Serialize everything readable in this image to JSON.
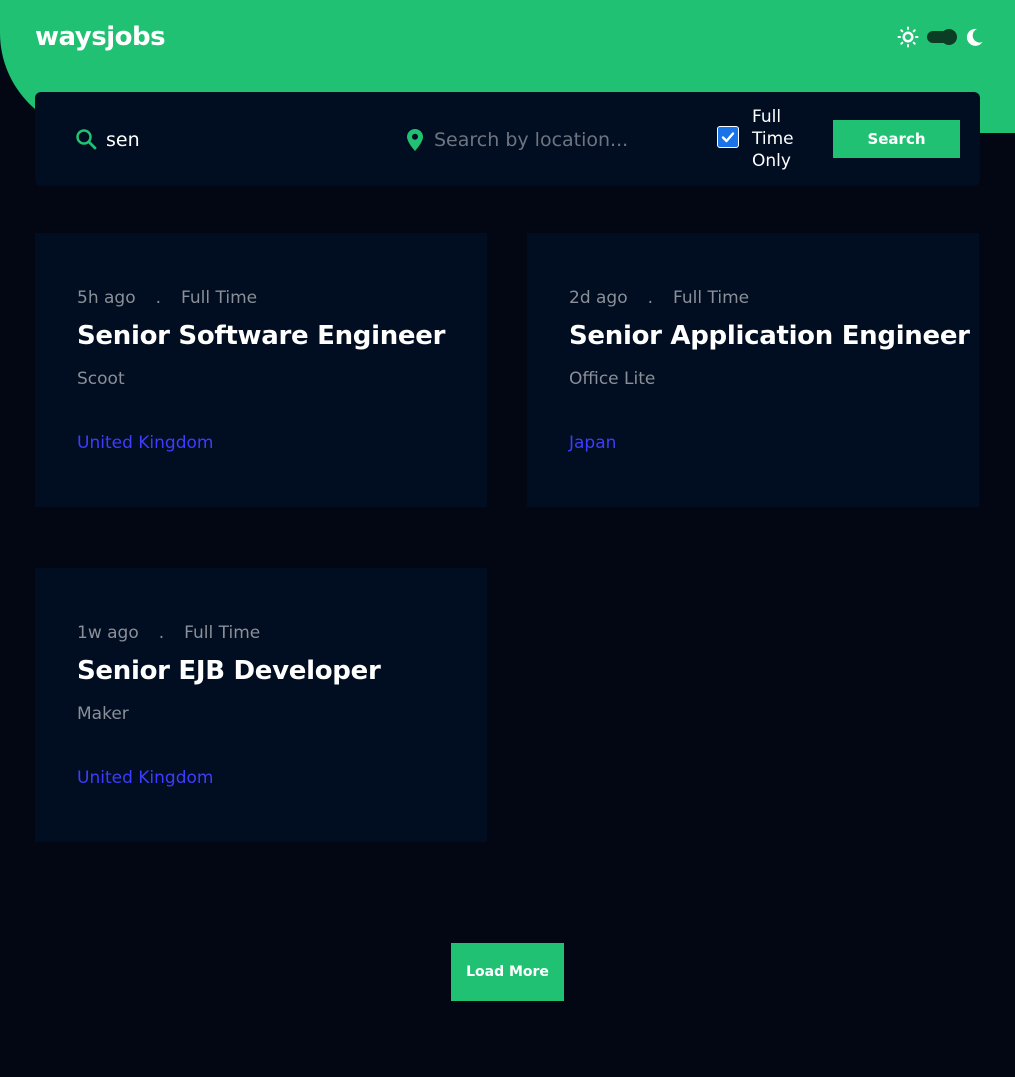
{
  "app": {
    "logo": "waysjobs"
  },
  "theme": {
    "light_icon": "sun-icon",
    "dark_icon": "moon-icon",
    "mode": "dark"
  },
  "search": {
    "title_value": "sen",
    "title_icon": "search-icon",
    "location_value": "",
    "location_placeholder": "Search by location...",
    "location_icon": "map-pin-icon",
    "fulltime_checked": true,
    "fulltime_label": "Full Time Only",
    "button_label": "Search"
  },
  "jobs": [
    {
      "posted": "5h ago",
      "separator": ".",
      "contract": "Full Time",
      "title": "Senior Software Engineer",
      "company": "Scoot",
      "location": "United Kingdom"
    },
    {
      "posted": "2d ago",
      "separator": ".",
      "contract": "Full Time",
      "title": "Senior Application Engineer",
      "company": "Office Lite",
      "location": "Japan"
    },
    {
      "posted": "1w ago",
      "separator": ".",
      "contract": "Full Time",
      "title": "Senior EJB Developer",
      "company": "Maker",
      "location": "United Kingdom"
    }
  ],
  "load_more": {
    "label": "Load More"
  },
  "colors": {
    "accent": "#21c173",
    "background": "#020713",
    "card": "#010d20",
    "location_link": "#3d3dff",
    "muted_text": "#8a8f98"
  }
}
